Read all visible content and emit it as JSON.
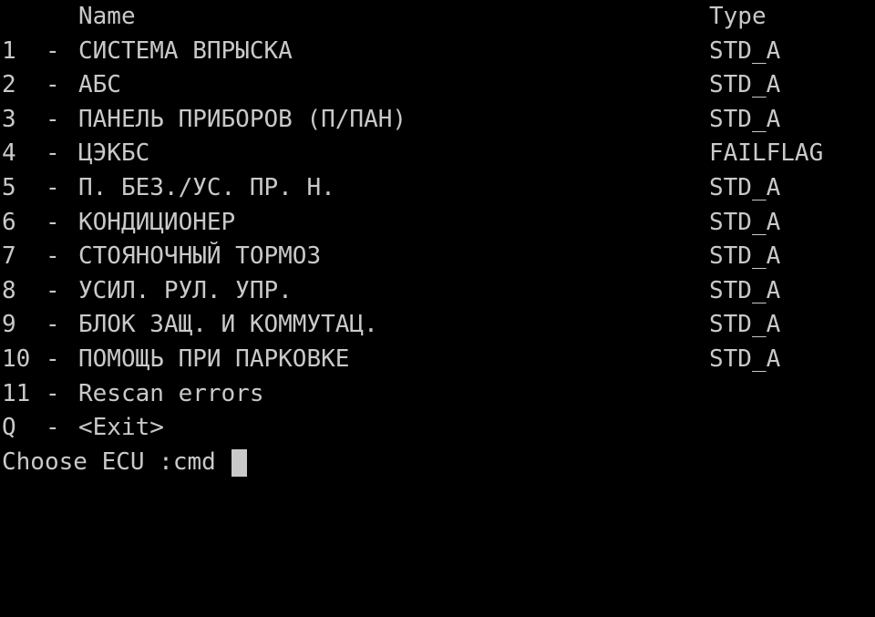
{
  "terminal": {
    "background_color": "#000000",
    "text_color": "#c9c9c9",
    "columns": {
      "name_header": "Name",
      "type_header": "Type"
    },
    "separator": "-",
    "rows": [
      {
        "index": "1",
        "separator": "-",
        "name": "СИСТЕМА ВПРЫСКА",
        "type": "STD_A"
      },
      {
        "index": "2",
        "separator": "-",
        "name": "АБС",
        "type": "STD_A"
      },
      {
        "index": "3",
        "separator": "-",
        "name": "ПАНЕЛЬ ПРИБОРОВ (П/ПАН)",
        "type": "STD_A"
      },
      {
        "index": "4",
        "separator": "-",
        "name": "ЦЭКБС",
        "type": "FAILFLAG"
      },
      {
        "index": "5",
        "separator": "-",
        "name": "П. БЕЗ./УС. ПР. Н.",
        "type": "STD_A"
      },
      {
        "index": "6",
        "separator": "-",
        "name": "КОНДИЦИОНЕР",
        "type": "STD_A"
      },
      {
        "index": "7",
        "separator": "-",
        "name": "СТОЯНОЧНЫЙ ТОРМОЗ",
        "type": "STD_A"
      },
      {
        "index": "8",
        "separator": "-",
        "name": "УСИЛ. РУЛ. УПР.",
        "type": "STD_A"
      },
      {
        "index": "9",
        "separator": "-",
        "name": "БЛОК ЗАЩ. И КОММУТАЦ.",
        "type": "STD_A"
      },
      {
        "index": "10",
        "separator": "-",
        "name": "ПОМОЩЬ ПРИ ПАРКОВКЕ",
        "type": "STD_A"
      },
      {
        "index": "11",
        "separator": "-",
        "name": "Rescan errors",
        "type": ""
      },
      {
        "index": "Q",
        "separator": "-",
        "name": "<Exit>",
        "type": ""
      }
    ],
    "prompt": {
      "text": "Choose ECU :cmd",
      "cursor": "block"
    }
  }
}
